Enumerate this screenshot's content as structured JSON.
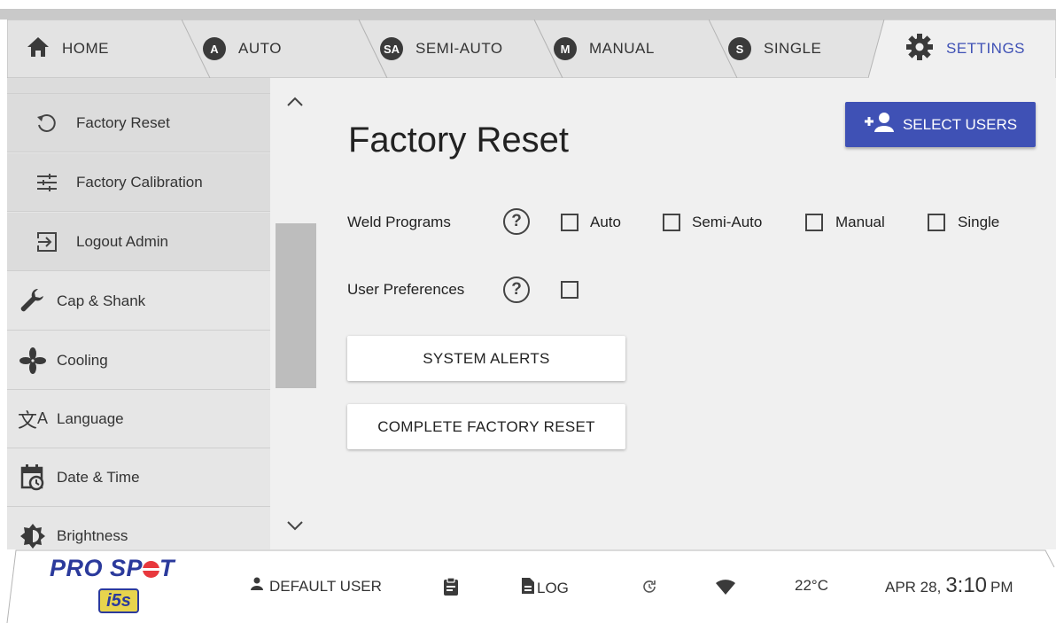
{
  "tabs": [
    {
      "label": "HOME",
      "icon": "home-icon"
    },
    {
      "label": "AUTO",
      "badge": "A"
    },
    {
      "label": "SEMI-AUTO",
      "badge": "SA"
    },
    {
      "label": "MANUAL",
      "badge": "M"
    },
    {
      "label": "SINGLE",
      "badge": "S"
    },
    {
      "label": "SETTINGS",
      "icon": "gear-icon"
    }
  ],
  "sidebar": {
    "items": [
      {
        "label": "Factory Reset",
        "icon": "reset-icon"
      },
      {
        "label": "Factory Calibration",
        "icon": "sliders-icon"
      },
      {
        "label": "Logout Admin",
        "icon": "logout-icon"
      },
      {
        "label": "Cap & Shank",
        "icon": "wrench-icon"
      },
      {
        "label": "Cooling",
        "icon": "fan-icon"
      },
      {
        "label": "Language",
        "icon": "translate-icon"
      },
      {
        "label": "Date & Time",
        "icon": "calendar-clock-icon"
      },
      {
        "label": "Brightness",
        "icon": "brightness-icon"
      }
    ]
  },
  "main": {
    "title": "Factory Reset",
    "select_users": "SELECT USERS",
    "weld_programs": {
      "label": "Weld Programs",
      "options": [
        "Auto",
        "Semi-Auto",
        "Manual",
        "Single"
      ]
    },
    "user_preferences": {
      "label": "User Preferences"
    },
    "help_glyph": "?",
    "system_alerts": "SYSTEM ALERTS",
    "complete_reset": "COMPLETE FACTORY RESET"
  },
  "footer": {
    "logo_text_a": "PRO SP",
    "logo_text_b": "T",
    "logo_badge": "i5s",
    "user": "DEFAULT USER",
    "log": "LOG",
    "temperature": "22°C",
    "date": "APR 28,",
    "time": "3:10",
    "ampm": "PM"
  },
  "colors": {
    "accent": "#3f51b5",
    "sidebar": "#e6e6e6",
    "main_bg": "#f0f0f0"
  }
}
